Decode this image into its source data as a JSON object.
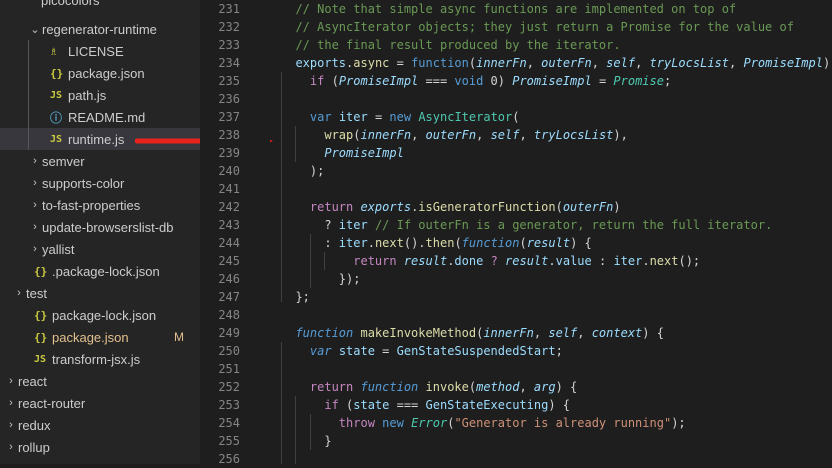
{
  "explorer": {
    "top_partial": "picocolors",
    "items": [
      {
        "label": "regenerator-runtime",
        "chevron": "⌄",
        "icon": "",
        "icon_name": "folder-open-icon"
      },
      {
        "label": "LICENSE",
        "chevron": "",
        "icon": "♗",
        "icon_name": "license-icon"
      },
      {
        "label": "package.json",
        "chevron": "",
        "icon": "{}",
        "icon_name": "json-file-icon"
      },
      {
        "label": "path.js",
        "chevron": "",
        "icon": "JS",
        "icon_name": "js-file-icon"
      },
      {
        "label": "README.md",
        "chevron": "",
        "icon": "ⓘ",
        "icon_name": "info-file-icon"
      },
      {
        "label": "runtime.js",
        "chevron": "",
        "icon": "JS",
        "icon_name": "js-file-icon"
      },
      {
        "label": "semver",
        "chevron": "›",
        "icon": "",
        "icon_name": "folder-closed-icon"
      },
      {
        "label": "supports-color",
        "chevron": "›",
        "icon": "",
        "icon_name": "folder-closed-icon"
      },
      {
        "label": "to-fast-properties",
        "chevron": "›",
        "icon": "",
        "icon_name": "folder-closed-icon"
      },
      {
        "label": "update-browserslist-db",
        "chevron": "›",
        "icon": "",
        "icon_name": "folder-closed-icon"
      },
      {
        "label": "yallist",
        "chevron": "›",
        "icon": "",
        "icon_name": "folder-closed-icon"
      },
      {
        "label": ".package-lock.json",
        "chevron": "",
        "icon": "{}",
        "icon_name": "json-file-icon"
      },
      {
        "label": "test",
        "chevron": "›",
        "icon": "",
        "icon_name": "folder-closed-icon"
      },
      {
        "label": "package-lock.json",
        "chevron": "",
        "icon": "{}",
        "icon_name": "json-file-icon"
      },
      {
        "label": "package.json",
        "chevron": "",
        "icon": "{}",
        "icon_name": "json-file-icon",
        "badge": "M"
      },
      {
        "label": "transform-jsx.js",
        "chevron": "",
        "icon": "JS",
        "icon_name": "js-file-icon"
      },
      {
        "label": "react",
        "chevron": "›",
        "icon": "",
        "icon_name": "folder-closed-icon"
      },
      {
        "label": "react-router",
        "chevron": "›",
        "icon": "",
        "icon_name": "folder-closed-icon"
      },
      {
        "label": "redux",
        "chevron": "›",
        "icon": "",
        "icon_name": "folder-closed-icon"
      },
      {
        "label": "rollup",
        "chevron": "›",
        "icon": "",
        "icon_name": "folder-closed-icon"
      }
    ]
  },
  "editor": {
    "line_numbers": [
      "231",
      "232",
      "233",
      "234",
      "235",
      "236",
      "237",
      "238",
      "239",
      "240",
      "241",
      "242",
      "243",
      "244",
      "245",
      "246",
      "247",
      "248",
      "249",
      "250",
      "251",
      "252",
      "253",
      "254",
      "255",
      "256"
    ],
    "lines": [
      [
        [
          "cm",
          "  // Note that simple async functions are implemented on top of"
        ]
      ],
      [
        [
          "cm",
          "  // AsyncIterator objects; they just return a Promise for the value of"
        ]
      ],
      [
        [
          "cm",
          "  // the final result produced by the iterator."
        ]
      ],
      [
        [
          "vr",
          "  exports"
        ],
        [
          "op",
          "."
        ],
        [
          "fn",
          "async"
        ],
        [
          "op",
          " = "
        ],
        [
          "kw",
          "function"
        ],
        [
          "op",
          "("
        ],
        [
          "vr it",
          "innerFn"
        ],
        [
          "op",
          ", "
        ],
        [
          "vr it",
          "outerFn"
        ],
        [
          "op",
          ", "
        ],
        [
          "vr it",
          "self"
        ],
        [
          "op",
          ", "
        ],
        [
          "vr it",
          "tryLocsList"
        ],
        [
          "op",
          ", "
        ],
        [
          "vr it",
          "PromiseImpl"
        ],
        [
          "op",
          ") {"
        ]
      ],
      [
        [
          "ctl",
          "    if"
        ],
        [
          "op",
          " ("
        ],
        [
          "vr it",
          "PromiseImpl"
        ],
        [
          "op",
          " === "
        ],
        [
          "kw",
          "void"
        ],
        [
          "op",
          " 0) "
        ],
        [
          "vr it",
          "PromiseImpl"
        ],
        [
          "op",
          " = "
        ],
        [
          "cls it",
          "Promise"
        ],
        [
          "op",
          ";"
        ]
      ],
      [
        [
          "op",
          ""
        ]
      ],
      [
        [
          "kw",
          "    var"
        ],
        [
          "op",
          " "
        ],
        [
          "vr",
          "iter"
        ],
        [
          "op",
          " = "
        ],
        [
          "kw",
          "new"
        ],
        [
          "op",
          " "
        ],
        [
          "cls",
          "AsyncIterator"
        ],
        [
          "op",
          "("
        ]
      ],
      [
        [
          "op",
          "      "
        ],
        [
          "fn",
          "wrap"
        ],
        [
          "op",
          "("
        ],
        [
          "vr it",
          "innerFn"
        ],
        [
          "op",
          ", "
        ],
        [
          "vr it",
          "outerFn"
        ],
        [
          "op",
          ", "
        ],
        [
          "vr it",
          "self"
        ],
        [
          "op",
          ", "
        ],
        [
          "vr it",
          "tryLocsList"
        ],
        [
          "op",
          "),"
        ]
      ],
      [
        [
          "op",
          "      "
        ],
        [
          "vr it",
          "PromiseImpl"
        ]
      ],
      [
        [
          "op",
          "    );"
        ]
      ],
      [
        [
          "op",
          ""
        ]
      ],
      [
        [
          "ctl",
          "    return"
        ],
        [
          "op",
          " "
        ],
        [
          "vr it",
          "exports"
        ],
        [
          "op",
          "."
        ],
        [
          "fn",
          "isGeneratorFunction"
        ],
        [
          "op",
          "("
        ],
        [
          "vr it",
          "outerFn"
        ],
        [
          "op",
          ")"
        ]
      ],
      [
        [
          "op",
          "      ? "
        ],
        [
          "vr",
          "iter"
        ],
        [
          "op",
          " "
        ],
        [
          "cm",
          "// If outerFn is a generator, return the full iterator."
        ]
      ],
      [
        [
          "op",
          "      : "
        ],
        [
          "vr",
          "iter"
        ],
        [
          "op",
          "."
        ],
        [
          "fn",
          "next"
        ],
        [
          "op",
          "()."
        ],
        [
          "fn",
          "then"
        ],
        [
          "op",
          "("
        ],
        [
          "kw it",
          "function"
        ],
        [
          "op",
          "("
        ],
        [
          "vr it",
          "result"
        ],
        [
          "op",
          ") {"
        ]
      ],
      [
        [
          "ctl",
          "          return"
        ],
        [
          "op",
          " "
        ],
        [
          "vr it",
          "result"
        ],
        [
          "op",
          "."
        ],
        [
          "vr",
          "done"
        ],
        [
          "op",
          " "
        ],
        [
          "ctl",
          "?"
        ],
        [
          "op",
          " "
        ],
        [
          "vr it",
          "result"
        ],
        [
          "op",
          "."
        ],
        [
          "vr",
          "value"
        ],
        [
          "op",
          " : "
        ],
        [
          "vr",
          "iter"
        ],
        [
          "op",
          "."
        ],
        [
          "fn",
          "next"
        ],
        [
          "op",
          "();"
        ]
      ],
      [
        [
          "op",
          "        });"
        ]
      ],
      [
        [
          "op",
          "  };"
        ]
      ],
      [
        [
          "op",
          ""
        ]
      ],
      [
        [
          "kw it",
          "  function"
        ],
        [
          "op",
          " "
        ],
        [
          "fn",
          "makeInvokeMethod"
        ],
        [
          "op",
          "("
        ],
        [
          "vr it",
          "innerFn"
        ],
        [
          "op",
          ", "
        ],
        [
          "vr it",
          "self"
        ],
        [
          "op",
          ", "
        ],
        [
          "vr it",
          "context"
        ],
        [
          "op",
          ") {"
        ]
      ],
      [
        [
          "kw it",
          "    var"
        ],
        [
          "op",
          " "
        ],
        [
          "vr",
          "state"
        ],
        [
          "op",
          " = "
        ],
        [
          "vr",
          "GenStateSuspendedStart"
        ],
        [
          "op",
          ";"
        ]
      ],
      [
        [
          "op",
          ""
        ]
      ],
      [
        [
          "ctl",
          "    return"
        ],
        [
          "op",
          " "
        ],
        [
          "kw it",
          "function"
        ],
        [
          "op",
          " "
        ],
        [
          "fn",
          "invoke"
        ],
        [
          "op",
          "("
        ],
        [
          "vr it",
          "method"
        ],
        [
          "op",
          ", "
        ],
        [
          "vr it",
          "arg"
        ],
        [
          "op",
          ") {"
        ]
      ],
      [
        [
          "ctl",
          "      if"
        ],
        [
          "op",
          " ("
        ],
        [
          "vr",
          "state"
        ],
        [
          "op",
          " === "
        ],
        [
          "vr",
          "GenStateExecuting"
        ],
        [
          "op",
          ") {"
        ]
      ],
      [
        [
          "ctl",
          "        throw"
        ],
        [
          "op",
          " "
        ],
        [
          "kw",
          "new"
        ],
        [
          "op",
          " "
        ],
        [
          "cls it",
          "Error"
        ],
        [
          "op",
          "("
        ],
        [
          "str",
          "\"Generator is already running\""
        ],
        [
          "op",
          ");"
        ]
      ],
      [
        [
          "op",
          "      }"
        ]
      ],
      [
        [
          "op",
          ""
        ]
      ]
    ]
  },
  "colors": {
    "accent_arrow": "#e8231c",
    "modified": "#e2c08d",
    "selected_row": "#37373d"
  }
}
